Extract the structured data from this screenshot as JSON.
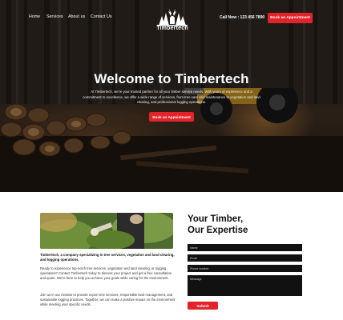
{
  "nav": {
    "links": [
      "Home",
      "Services",
      "About us",
      "Contact Us"
    ],
    "logo_text": "Timbertech",
    "call": "Call Now : 123 456 7890",
    "cta": "Book an Appointment"
  },
  "hero": {
    "title": "Welcome to Timbertech",
    "subtitle": "At Timbertech, we're your trusted partner for all your timber service needs. With years of experience and a commitment to excellence, we offer a wide range of services, from tree care and maintenance to vegetation and land clearing, and professional logging operations.",
    "button": "Book an Appointment"
  },
  "about": {
    "heading": "Timbertech, a company specializing in tree services, vegetation and land clearing, and logging operations.",
    "p1": "Ready to experience top-notch tree services, vegetation and land clearing, or logging operations? Contact Timbertech today to discuss your project and get a free consultation and quote. We're here to help you achieve your goals while caring for the environment.",
    "p2": "Join us in our mission to provide expert tree services, responsible land management, and sustainable logging practices. Together, we can make a positive impact on the environment while meeting your specific needs."
  },
  "form": {
    "title_line1": "Your Timber,",
    "title_line2": "Our Expertise",
    "name_placeholder": "Name",
    "email_placeholder": "Email",
    "phone_placeholder": "Phone number",
    "message_placeholder": "Message",
    "submit": "Submit"
  },
  "colors": {
    "accent": "#e3222a",
    "field": "#111111",
    "text": "#111111"
  }
}
